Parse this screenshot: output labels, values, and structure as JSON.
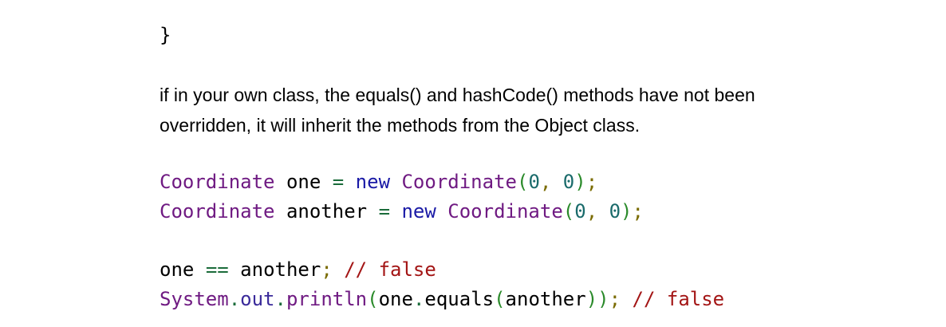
{
  "snippet_top": {
    "closing_brace": "}"
  },
  "paragraph": {
    "line1": "if in your own class, the equals() and hashCode() methods have not been",
    "line2": "overridden, it will inherit the methods from the Object class."
  },
  "declarations": {
    "line1": {
      "type": "Coordinate",
      "var": "one",
      "assign": "=",
      "new_kw": "new",
      "ctor": "Coordinate",
      "open": "(",
      "arg1": "0",
      "comma": ",",
      "arg2": "0",
      "close": ")",
      "semi": ";"
    },
    "line2": {
      "type": "Coordinate",
      "var": "another",
      "assign": "=",
      "new_kw": "new",
      "ctor": "Coordinate",
      "open": "(",
      "arg1": "0",
      "comma": ",",
      "arg2": "0",
      "close": ")",
      "semi": ";"
    }
  },
  "comparisons": {
    "line1": {
      "left": "one",
      "op": "==",
      "right": "another",
      "semi": ";",
      "comment": "// false"
    },
    "line2": {
      "system": "System",
      "dot1": ".",
      "out": "out",
      "dot2": ".",
      "println": "println",
      "open1": "(",
      "obj": "one",
      "dot3": ".",
      "equals": "equals",
      "open2": "(",
      "arg": "another",
      "close2": ")",
      "close1": ")",
      "semi": ";",
      "comment": "// false"
    }
  }
}
